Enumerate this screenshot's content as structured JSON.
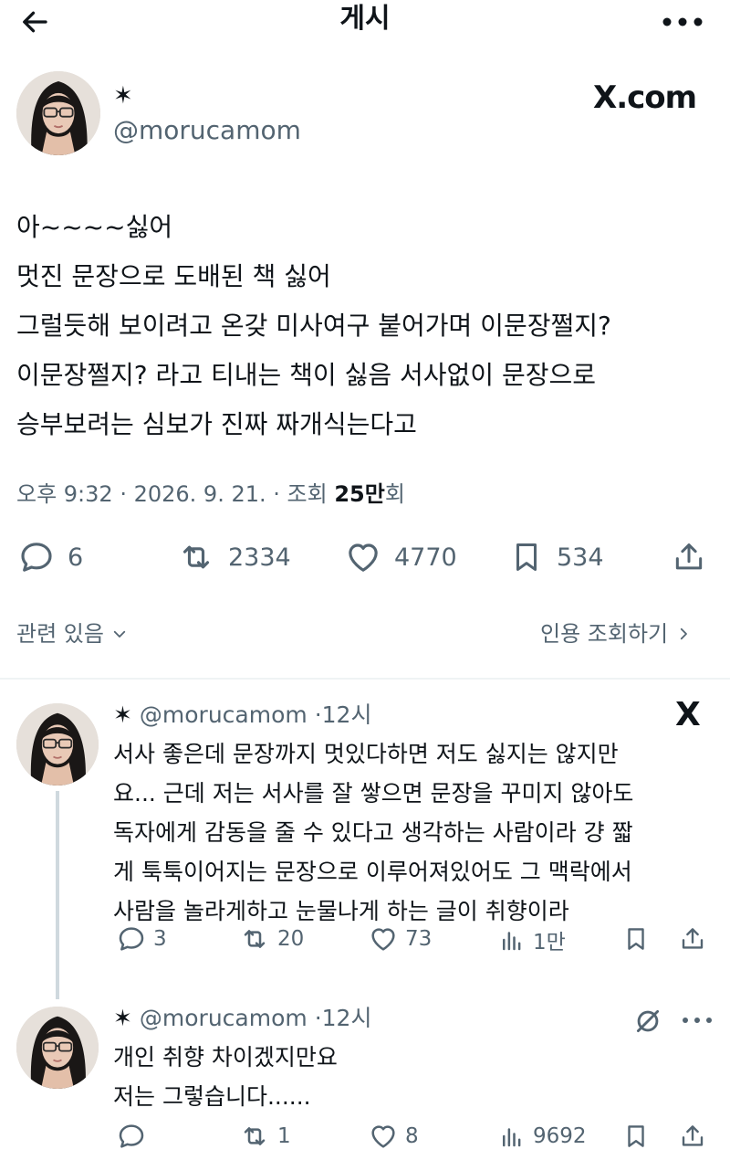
{
  "header": {
    "title": "게시",
    "back_icon": "arrow-left-icon",
    "more_icon": "more-horizontal-icon"
  },
  "post": {
    "author_name": "✶",
    "handle": "@morucamom",
    "brand": "X.com",
    "body_lines": [
      "아~~~~싫어",
      "멋진 문장으로 도배된 책 싫어",
      "그럴듯해 보이려고 온갖 미사여구 붙어가며 이문장쩔지?",
      "이문장쩔지? 라고 티내는 책이 싫음 서사없이 문장으로",
      "승부보려는 심보가 진짜 짜개식는다고"
    ],
    "time": "오후 9:32",
    "date": "2026. 9. 21.",
    "views_label": "조회",
    "views_count": "25만",
    "views_suffix": "회",
    "replies": "6",
    "reposts": "2334",
    "likes": "4770",
    "bookmarks": "534",
    "related_label": "관련 있음",
    "quotes_label": "인용 조회하기"
  },
  "replies": [
    {
      "author_name": "✶",
      "handle": "@morucamom",
      "time": "12시",
      "body_lines": [
        "서사 좋은데 문장까지 멋있다하면 저도 싫지는 않지만",
        "요... 근데 저는 서사를 잘 쌓으면 문장을 꾸미지 않아도",
        "독자에게 감동을 줄 수 있다고 생각하는 사람이라 걍 짧",
        "게 툭툭이어지는 문장으로 이루어져있어도 그 맥락에서",
        "사람을 놀라게하고 눈물나게 하는 글이 취향이라"
      ],
      "replies": "3",
      "reposts": "20",
      "likes": "73",
      "views": "1만",
      "brand_icon": "X"
    },
    {
      "author_name": "✶",
      "handle": "@morucamom",
      "time": "12시",
      "body_lines": [
        "개인 취향 차이겠지만요",
        "저는 그렇습니다......"
      ],
      "replies": "",
      "reposts": "1",
      "likes": "8",
      "views": "9692"
    }
  ],
  "colors": {
    "text": "#0f1419",
    "secondary": "#536471",
    "divider": "#eff3f4",
    "thread_line": "#cfd9de"
  }
}
